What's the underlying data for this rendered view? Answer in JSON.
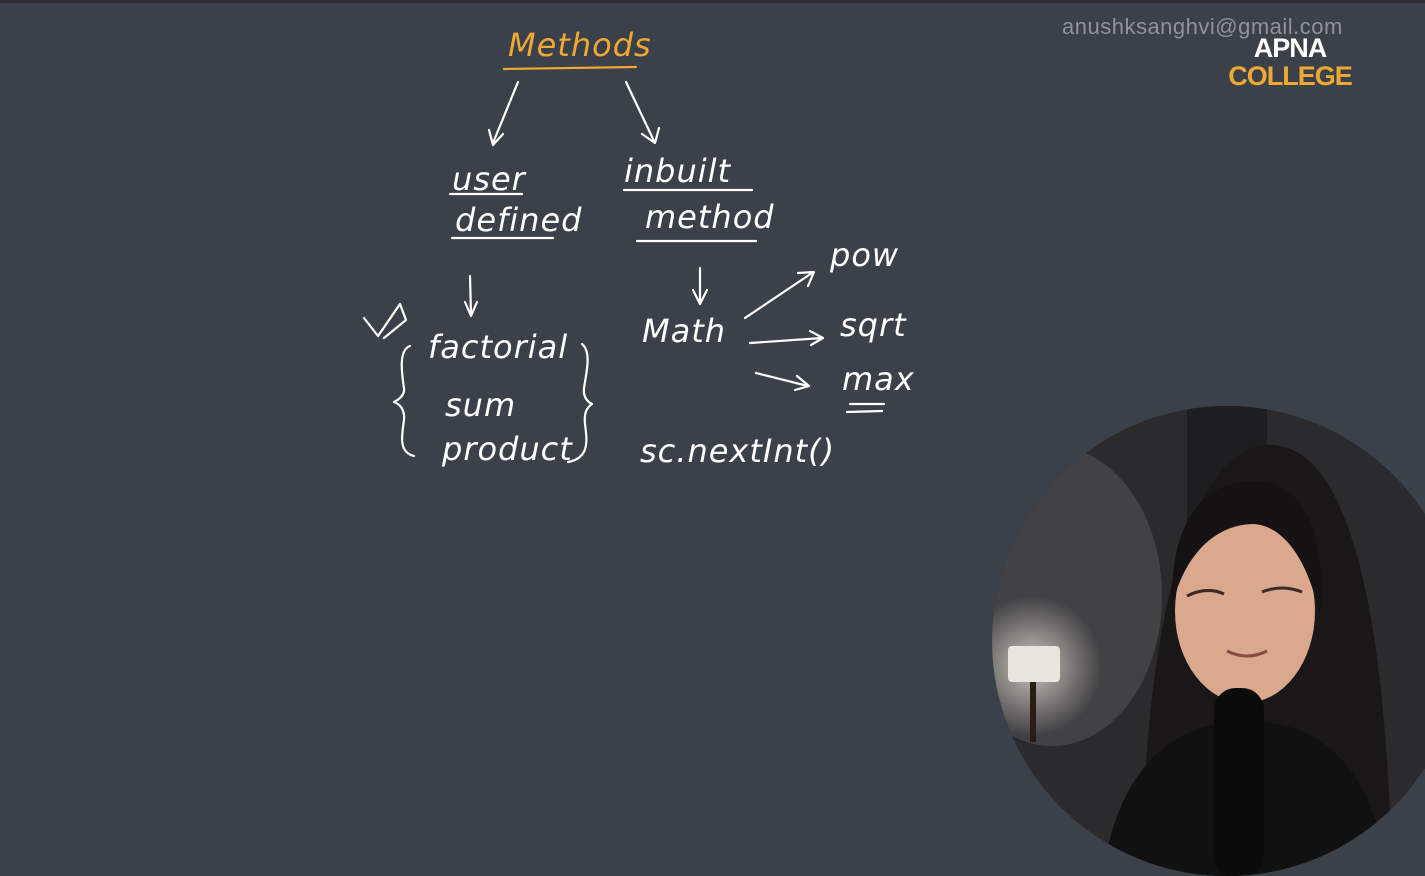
{
  "watermark": "anushksanghvi@gmail.com",
  "logo": {
    "line1": "APNA",
    "line2": "COLLEGE"
  },
  "diagram": {
    "root": "Methods",
    "left_branch": {
      "line1": "user",
      "line2": "defined"
    },
    "right_branch": {
      "line1": "inbuilt",
      "line2": "method"
    },
    "user_defined_examples": [
      "factorial",
      "sum",
      "product"
    ],
    "inbuilt_class": "Math",
    "math_methods": [
      "pow",
      "sqrt",
      "max"
    ],
    "scanner_example": "sc.nextInt()"
  },
  "colors": {
    "board": "#3b414a",
    "ink": "#ffffff",
    "accent": "#f0a832"
  }
}
